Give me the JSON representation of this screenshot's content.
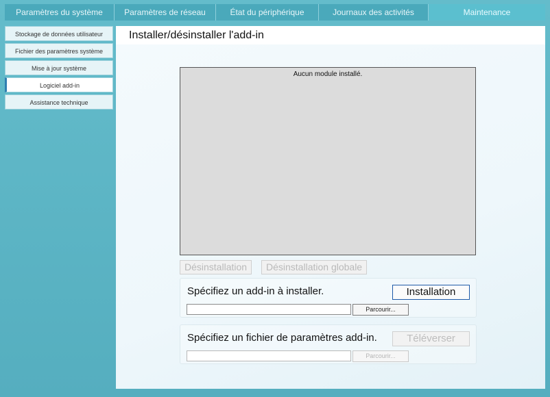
{
  "tabs": [
    {
      "label": "Paramètres du système"
    },
    {
      "label": "Paramètres de réseau"
    },
    {
      "label": "État du périphérique"
    },
    {
      "label": "Journaux des activités"
    },
    {
      "label": "Maintenance"
    }
  ],
  "sidebar": {
    "items": [
      {
        "label": "Stockage de données utilisateur"
      },
      {
        "label": "Fichier des paramètres système"
      },
      {
        "label": "Mise à jour système"
      },
      {
        "label": "Logiciel add-in"
      },
      {
        "label": "Assistance technique"
      }
    ]
  },
  "main": {
    "title": "Installer/désinstaller l'add-in",
    "module_list_empty": "Aucun module installé.",
    "uninstall_label": "Désinstallation",
    "uninstall_all_label": "Désinstallation globale",
    "install_section": {
      "label": "Spécifiez un add-in à installer.",
      "button_label": "Installation",
      "browse_label": "Parcourir..."
    },
    "upload_section": {
      "label": "Spécifiez un fichier de paramètres add-in.",
      "button_label": "Téléverser",
      "browse_label": "Parcourir..."
    }
  }
}
